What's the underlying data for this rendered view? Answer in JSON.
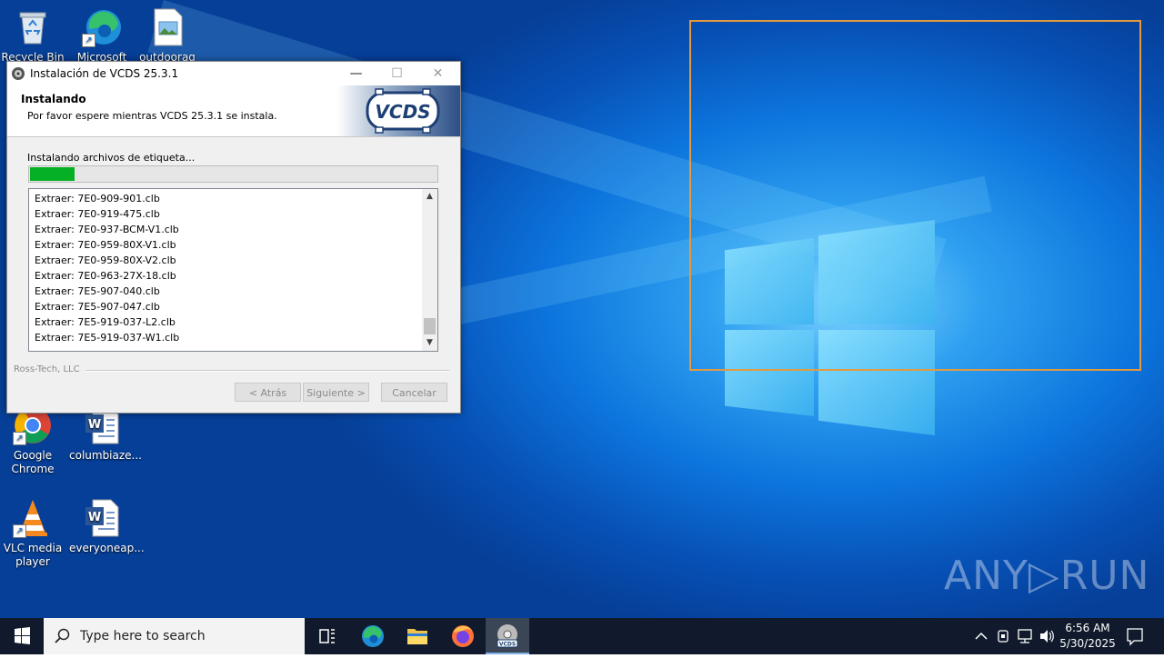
{
  "desktop": {
    "icons": [
      {
        "label": "Recycle Bin"
      },
      {
        "label": "Microsoft"
      },
      {
        "label": "outdoorag"
      },
      {
        "label": "Google Chrome"
      },
      {
        "label": "columbiaze..."
      },
      {
        "label": "VLC media player"
      },
      {
        "label": "everyoneap..."
      }
    ],
    "watermark": "ANY▷RUN"
  },
  "dialog": {
    "title": "Instalación de VCDS 25.3.1",
    "header_title": "Instalando",
    "header_subtitle": "Por favor espere mientras VCDS 25.3.1 se instala.",
    "logo_text": "VCDS",
    "status_text": "Instalando archivos de etiqueta...",
    "progress": 0.11,
    "progress_color": "#06b025",
    "log_items": [
      "Extraer: 7E0-909-901.clb",
      "Extraer: 7E0-919-475.clb",
      "Extraer: 7E0-937-BCM-V1.clb",
      "Extraer: 7E0-959-80X-V1.clb",
      "Extraer: 7E0-959-80X-V2.clb",
      "Extraer: 7E0-963-27X-18.clb",
      "Extraer: 7E5-907-040.clb",
      "Extraer: 7E5-907-047.clb",
      "Extraer: 7E5-919-037-L2.clb",
      "Extraer: 7E5-919-037-W1.clb"
    ],
    "brand": "Ross-Tech, LLC",
    "buttons": {
      "back": "< Atrás",
      "next": "Siguiente >",
      "cancel": "Cancelar"
    }
  },
  "taskbar": {
    "search_placeholder": "Type here to search",
    "time": "6:56 AM",
    "date": "5/30/2025",
    "apps": [
      "task-view",
      "edge",
      "file-explorer",
      "firefox",
      "vcds-installer"
    ]
  },
  "colors": {
    "selection_rect": "#e39a3f",
    "taskbar": "#101a2c",
    "desktop_accent": "#0c74dc"
  }
}
